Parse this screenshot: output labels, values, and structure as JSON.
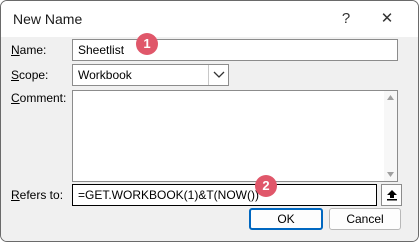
{
  "window": {
    "title": "New Name",
    "help_glyph": "?",
    "close_glyph": "✕"
  },
  "form": {
    "name_label_key": "N",
    "name_label_rest": "ame:",
    "name_value": "Sheetlist",
    "scope_label_key": "S",
    "scope_label_rest": "cope:",
    "scope_value": "Workbook",
    "comment_label_key": "C",
    "comment_label_rest": "omment:",
    "comment_value": "",
    "refers_label_key": "R",
    "refers_label_rest": "efers to:",
    "refers_value": "=GET.WORKBOOK(1)&T(NOW())"
  },
  "buttons": {
    "ok_label": "OK",
    "cancel_label": "Cancel"
  },
  "annotations": {
    "step1": "1",
    "step2": "2",
    "color": "#e0576a"
  },
  "icons": {
    "help": "help-icon",
    "close": "close-icon",
    "dropdown": "chevron-down-icon",
    "collapse": "collapse-dialog-icon",
    "scroll_up": "triangle-up-icon",
    "scroll_down": "triangle-down-icon"
  }
}
